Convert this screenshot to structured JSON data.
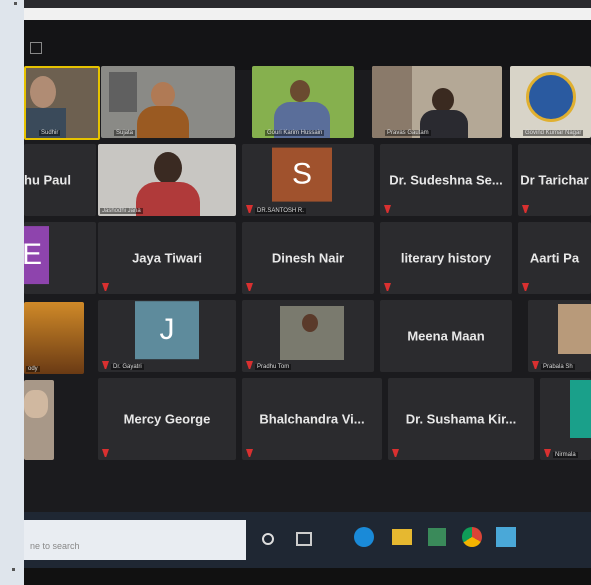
{
  "grid": {
    "tiles": [
      {
        "name": "",
        "label": "Sudhir",
        "kind": "video"
      },
      {
        "name": "",
        "label": "Sujata",
        "kind": "video"
      },
      {
        "name": "",
        "label": "Gouri Karim Hussain",
        "kind": "video"
      },
      {
        "name": "",
        "label": "Pravas Gautam",
        "kind": "video"
      },
      {
        "name": "",
        "label": "Govind Kumar Nagar",
        "kind": "video"
      },
      {
        "name": "hu Paul",
        "label": "",
        "kind": "name"
      },
      {
        "name": "",
        "label": "Jashodhi Jana",
        "kind": "video"
      },
      {
        "name": "",
        "label": "DR.SANTOSH R.",
        "kind": "avatar",
        "letter": "S"
      },
      {
        "name": "Dr. Sudeshna Se...",
        "label": "",
        "kind": "name"
      },
      {
        "name": "Dr Tarichar",
        "label": "",
        "kind": "name"
      },
      {
        "name": "",
        "label": "",
        "kind": "avatar",
        "letter": "E"
      },
      {
        "name": "Jaya Tiwari",
        "label": "",
        "kind": "name"
      },
      {
        "name": "Dinesh Nair",
        "label": "",
        "kind": "name"
      },
      {
        "name": "literary history",
        "label": "",
        "kind": "name"
      },
      {
        "name": "Aarti Pa",
        "label": "",
        "kind": "name"
      },
      {
        "name": "",
        "label": "ody",
        "kind": "video"
      },
      {
        "name": "",
        "label": "Dr. Gayatri",
        "kind": "avatar",
        "letter": "J"
      },
      {
        "name": "",
        "label": "Pradhu Tom",
        "kind": "video"
      },
      {
        "name": "Meena Maan",
        "label": "",
        "kind": "name"
      },
      {
        "name": "",
        "label": "Prabala Sh",
        "kind": "video"
      },
      {
        "name": "",
        "label": "",
        "kind": "video"
      },
      {
        "name": "Mercy George",
        "label": "",
        "kind": "name"
      },
      {
        "name": "Bhalchandra Vi...",
        "label": "",
        "kind": "name"
      },
      {
        "name": "Dr. Sushama Kir...",
        "label": "",
        "kind": "name"
      },
      {
        "name": "",
        "label": "Nirmala",
        "kind": "video"
      }
    ]
  },
  "taskbar": {
    "search_placeholder": "ne to search"
  },
  "colors": {
    "screen_bg": "#1b1b1e",
    "tile_bg": "#2b2b2e",
    "avatar_s": "#a0522d",
    "avatar_e": "#8e44ad",
    "avatar_j": "#5e8b9c",
    "active_border": "#e6c200",
    "taskbar_bg": "#1f2733"
  }
}
